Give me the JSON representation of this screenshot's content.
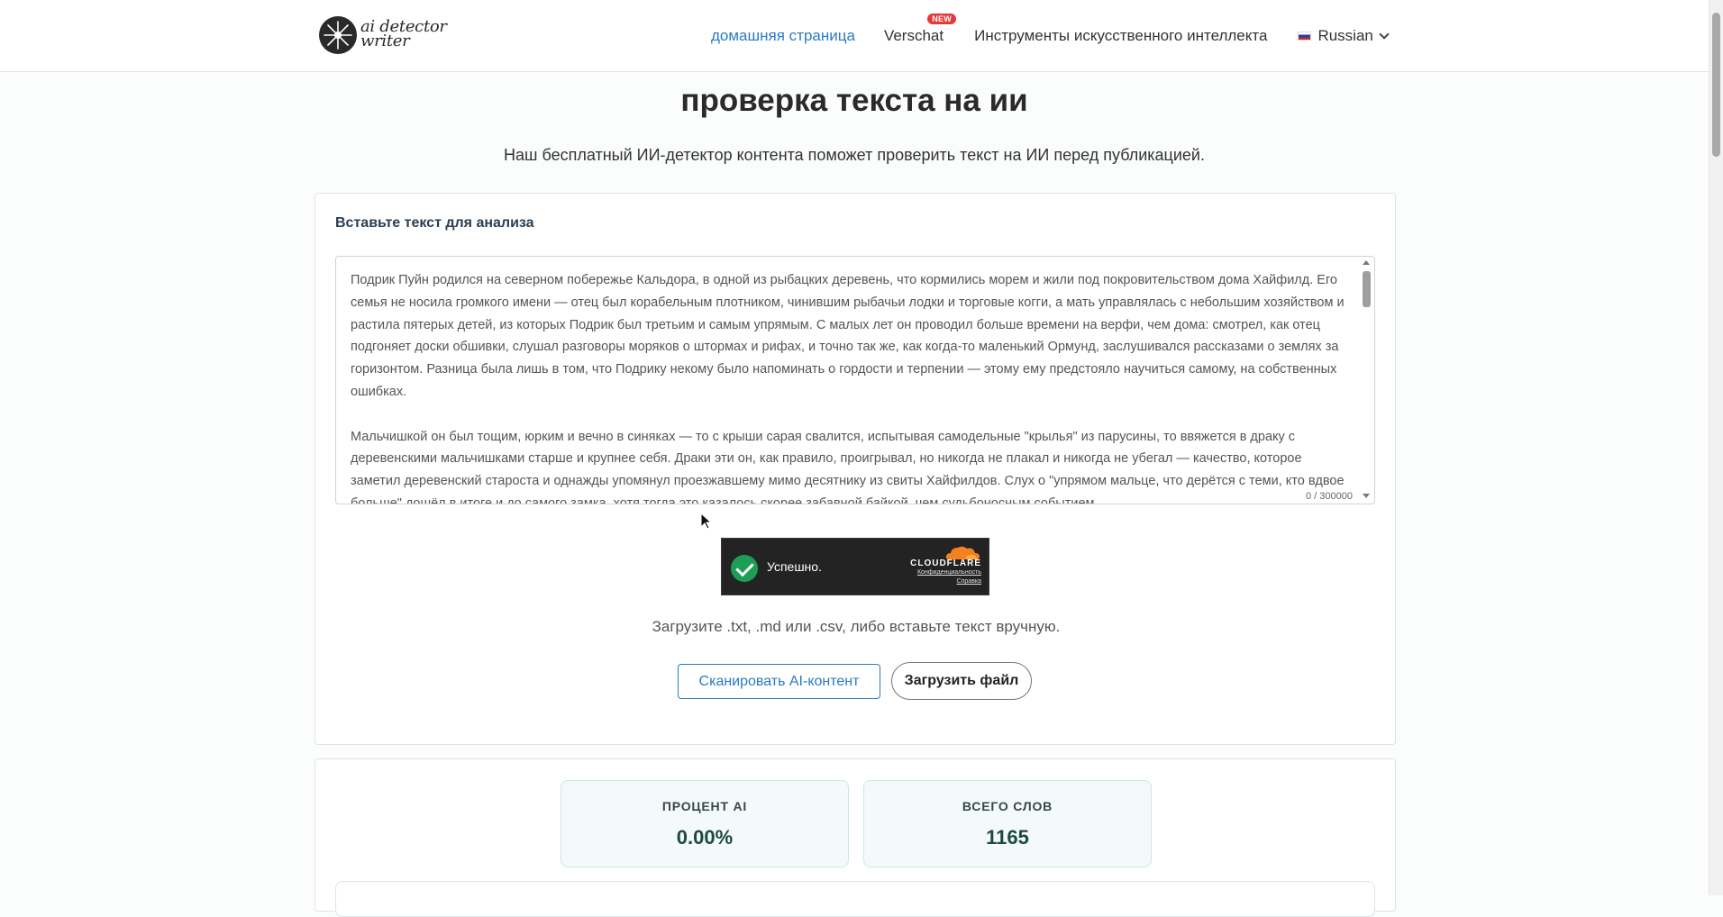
{
  "header": {
    "logo_line1": "ai detector",
    "logo_line2": "writer",
    "nav": {
      "home": "домашняя страница",
      "verschat": "Verschat",
      "verschat_badge": "NEW",
      "tools": "Инструменты искусственного интеллекта",
      "language": "Russian"
    }
  },
  "main": {
    "title": "проверка текста на ии",
    "subtitle": "Наш бесплатный ИИ-детектор контента поможет проверить текст на ИИ перед публикацией."
  },
  "input_card": {
    "label": "Вставьте текст для анализа",
    "text": "Подрик Пуйн родился на северном побережье Кальдора, в одной из рыбацких деревень, что кормились морем и жили под покровительством дома Хайфилд. Его семья не носила громкого имени — отец был корабельным плотником, чинившим рыбачьи лодки и торговые когги, а мать управлялась с небольшим хозяйством и растила пятерых детей, из которых Подрик был третьим и самым упрямым. С малых лет он проводил больше времени на верфи, чем дома: смотрел, как отец подгоняет доски обшивки, слушал разговоры моряков о штормах и рифах, и точно так же, как когда-то маленький Ормунд, заслушивался рассказами о землях за горизонтом. Разница была лишь в том, что Подрику некому было напоминать о гордости и терпении — этому ему предстояло научиться самому, на собственных ошибках.\n\nМальчишкой он был тощим, юрким и вечно в синяках — то с крыши сарая свалится, испытывая самодельные \"крылья\" из парусины, то ввяжется в драку с деревенскими мальчишками старше и крупнее себя. Драки эти он, как правило, проигрывал, но никогда не плакал и никогда не убегал — качество, которое заметил деревенский староста и однажды упомянул проезжавшему мимо десятнику из свиты Хайфилдов. Слух о \"упрямом мальце, что дерётся с теми, кто вдвое больше\" дошёл в итоге и до самого замка, хотя тогда это казалось скорее забавной байкой, чем судьбоносным событием.",
    "counter": "0 / 300000",
    "captcha": {
      "status": "Успешно.",
      "brand": "CLOUDFLARE",
      "privacy": "Конфиденциальность",
      "help": "Справка"
    },
    "upload_hint": "Загрузите .txt, .md или .csv, либо вставьте текст вручную.",
    "scan_button": "Сканировать AI-контент",
    "upload_button": "Загрузить файл"
  },
  "results": {
    "ai_percent_label": "ПРОЦЕНТ AI",
    "ai_percent_value": "0.00%",
    "total_words_label": "ВСЕГО СЛОВ",
    "total_words_value": "1165"
  },
  "colors": {
    "accent": "#2b7bc0",
    "badge": "#e53935",
    "success": "#1e9e55"
  }
}
